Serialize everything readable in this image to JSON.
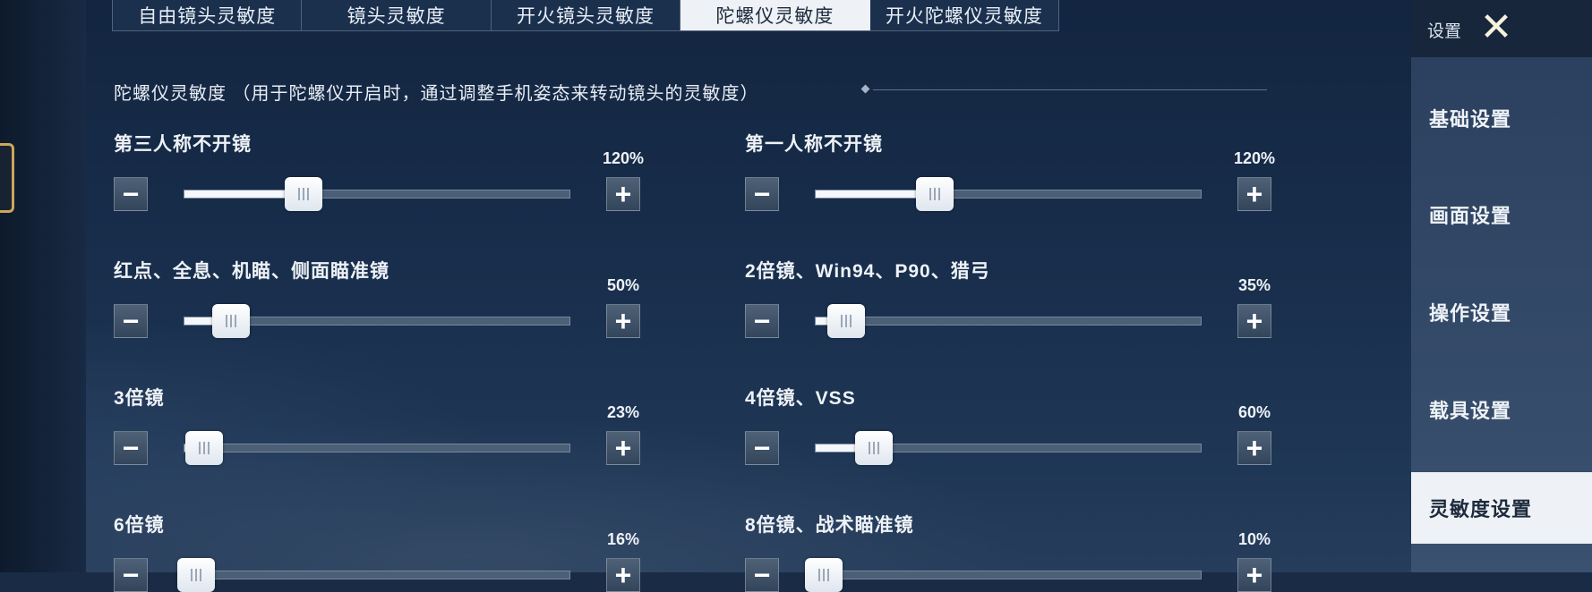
{
  "tabs": [
    {
      "label": "自由镜头灵敏度",
      "active": false
    },
    {
      "label": "镜头灵敏度",
      "active": false
    },
    {
      "label": "开火镜头灵敏度",
      "active": false
    },
    {
      "label": "陀螺仪灵敏度",
      "active": true
    },
    {
      "label": "开火陀螺仪灵敏度",
      "active": false
    }
  ],
  "section": {
    "title": "陀螺仪灵敏度 （用于陀螺仪开启时，通过调整手机姿态来转动镜头的灵敏度）"
  },
  "sliders": [
    {
      "label": "第三人称不开镜",
      "percent": "120%",
      "level": 0.31
    },
    {
      "label": "第一人称不开镜",
      "percent": "120%",
      "level": 0.31
    },
    {
      "label": "红点、全息、机瞄、侧面瞄准镜",
      "percent": "50%",
      "level": 0.12
    },
    {
      "label": "2倍镜、Win94、P90、猎弓",
      "percent": "35%",
      "level": 0.08
    },
    {
      "label": "3倍镜",
      "percent": "23%",
      "level": 0.05
    },
    {
      "label": "4倍镜、VSS",
      "percent": "60%",
      "level": 0.15
    },
    {
      "label": "6倍镜",
      "percent": "16%",
      "level": 0.03
    },
    {
      "label": "8倍镜、战术瞄准镜",
      "percent": "10%",
      "level": 0.02
    }
  ],
  "controls": {
    "minus": "−",
    "plus": "+"
  },
  "nav": {
    "title": "设置",
    "close_icon": "✕",
    "items": [
      {
        "label": "基础设置",
        "active": false
      },
      {
        "label": "画面设置",
        "active": false
      },
      {
        "label": "操作设置",
        "active": false
      },
      {
        "label": "载具设置",
        "active": false
      },
      {
        "label": "灵敏度设置",
        "active": true
      }
    ]
  }
}
